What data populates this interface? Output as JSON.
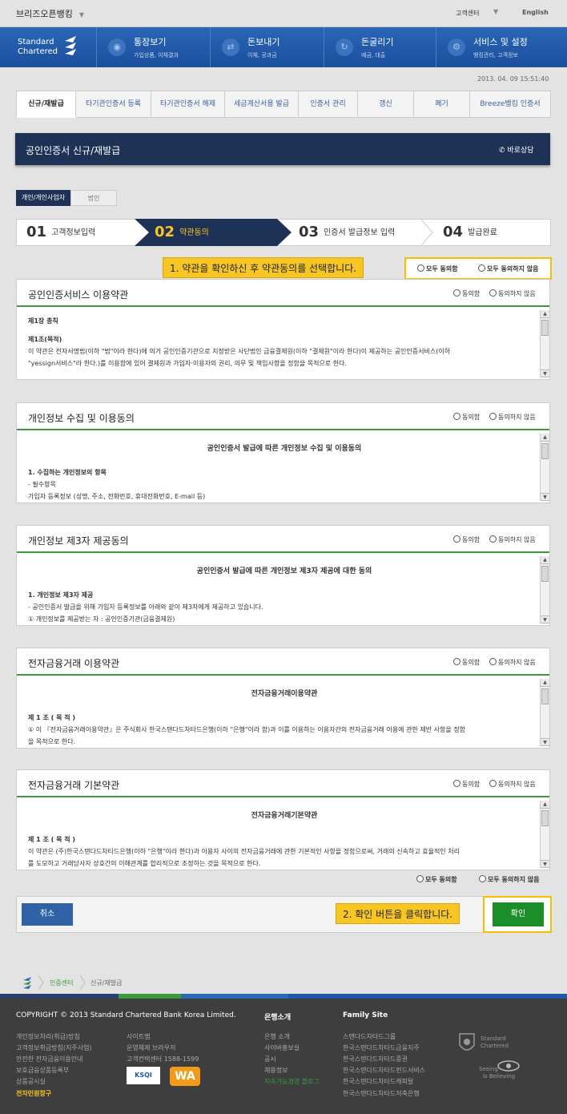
{
  "topbar": {
    "brand": "브리즈오픈뱅킹",
    "customer_center": "고객센터",
    "english": "English"
  },
  "logo": {
    "line1": "Standard",
    "line2": "Chartered"
  },
  "nav": [
    {
      "title": "통장보기",
      "sub": "가입상품, 이체결과",
      "icon": "eye-icon"
    },
    {
      "title": "돈보내기",
      "sub": "이체, 공과금",
      "icon": "transfer-icon"
    },
    {
      "title": "돈굴리기",
      "sub": "예금, 대출",
      "icon": "refresh-icon"
    },
    {
      "title": "서비스 및 설정",
      "sub": "뱅킹관리, 고객정보",
      "icon": "gear-icon"
    }
  ],
  "datetime": "2013. 04. 09 15:51:40",
  "tabs": [
    "신규/재발급",
    "타기관인증서 등록",
    "타기관인증서 해제",
    "세금계산서용 발급",
    "인증서 관리",
    "갱신",
    "폐기",
    "Breeze뱅킹 인증서"
  ],
  "page_title": "공인인증서 신규/재발급",
  "consult": "바로상담",
  "subtabs": [
    "개인/개인사업자",
    "법인"
  ],
  "steps": [
    {
      "num": "01",
      "label": "고객정보입력"
    },
    {
      "num": "02",
      "label": "약관동의"
    },
    {
      "num": "03",
      "label": "인증서 발급정보 입력"
    },
    {
      "num": "04",
      "label": "발급완료"
    }
  ],
  "callout1": "1. 약관을 확인하신 후 약관동의를 선택합니다.",
  "callout2": "2. 확인 버튼을 클릭합니다.",
  "agree_all": "모두 동의함",
  "disagree_all": "모두 동의하지 않음",
  "agree": "동의함",
  "disagree": "동의하지 않음",
  "sections": [
    {
      "title": "공인인증서비스 이용약관",
      "heading": "",
      "line1": "제1장 총칙",
      "line2": "제1조(목적)",
      "line3": "이 약관은 전자서명법(이하 \"법\"이라 한다)에 의거 공인인증기관으로 지정받은 사단법인 금융결제원(이하 \"결제원\"이라 한다)이 제공하는 공인인증서비스(이하",
      "line4": "\"yessign서비스\"라 한다.)를 이용함에 있어 결제원과 가입자·이용자의 권리, 의무 및 책임사항을 정함을 목적으로 한다."
    },
    {
      "title": "개인정보 수집 및 이용동의",
      "heading": "공인인증서 발급에 따른 개인정보 수집 및 이용동의",
      "line1": "1. 수집하는 개인정보의 항목",
      "line2": "- 필수항목",
      "line3": "가입자 등록정보 (성명, 주소, 전화번호, 휴대전화번호, E-mail 등)",
      "line4": ""
    },
    {
      "title": "개인정보 제3자 제공동의",
      "heading": "공인인증서 발급에 따른 개인정보 제3자 제공에 대한 동의",
      "line1": "1. 개인정보 제3자 제공",
      "line2": "- 공인인증서 발급을 위해 가입자 등록정보를 아래와 같이 제3자에게 제공하고 있습니다.",
      "line3": "① 개인정보를 제공받는 자 : 공인인증기관(금융결제원)",
      "line4": ""
    },
    {
      "title": "전자금융거래 이용약관",
      "heading": "전자금융거래이용약관",
      "line1": "제 1 조 ( 목 적 )",
      "line2": "① 이 『전자금융거래이용약관』은 주식회사 한국스탠다드차타드은행(이하 \"은행\"이라 함)과 이를 이용하는 이용자간의 전자금융거래 이용에 관한 제반 사항을 정함",
      "line3": "을 목적으로 한다.",
      "line4": ""
    },
    {
      "title": "전자금융거래 기본약관",
      "heading": "전자금융거래기본약관",
      "line1": "제 1 조 ( 목 적 )",
      "line2": "이 약관은 (주)한국스탠다드차타드은행(이하 \"은행\"이라 한다)과 이용자 사이의 전자금융거래에 관한 기본적인 사항을 정함으로써, 거래의 신속하고 효율적인 처리",
      "line3": "를 도모하고 거래당사자 상호간의 이해관계를 합리적으로 조정하는 것을 목적으로 한다.",
      "line4": ""
    }
  ],
  "buttons": {
    "cancel": "취소",
    "confirm": "확인"
  },
  "breadcrumb": [
    "인증센터",
    "신규/재발급"
  ],
  "footer": {
    "copyright": "COPYRIGHT © 2013 Standard Chartered Bank Korea Limited.",
    "col1": [
      "개인정보처리(취급)방침",
      "고객정보취급방침(지주사업)",
      "안전한 전자금융이용안내",
      "보호금융상품등록부",
      "상품공시실",
      "전자민원창구"
    ],
    "col2": [
      "사이트맵",
      "운영체제 브라우저",
      "고객컨택센터 1588-1599"
    ],
    "bank_title": "은행소개",
    "bank_links": [
      "은행 소개",
      "사이버홍보실",
      "공시",
      "채용정보",
      "지속가능경영 블로그"
    ],
    "family_title": "Family Site",
    "family_links": [
      "스탠다드차타드그룹",
      "한국스탠다드차타드금융지주",
      "한국스탠다드차타드증권",
      "한국스탠다드차타드펀드서비스",
      "한국스탠다드차타드캐피탈",
      "한국스탠다드차타드저축은행"
    ],
    "badge1": "KSQI",
    "badge2": "WA",
    "sc_logo_line1": "Standard",
    "sc_logo_line2": "Chartered",
    "seeing1": "Seeing",
    "seeing2": "is Believing"
  }
}
